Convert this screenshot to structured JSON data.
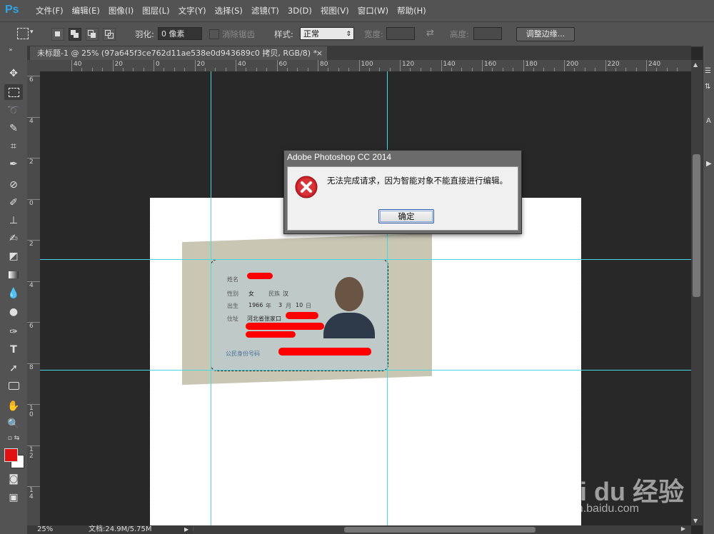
{
  "app": {
    "logo": "Ps"
  },
  "menu": [
    "文件(F)",
    "编辑(E)",
    "图像(I)",
    "图层(L)",
    "文字(Y)",
    "选择(S)",
    "滤镜(T)",
    "3D(D)",
    "视图(V)",
    "窗口(W)",
    "帮助(H)"
  ],
  "options": {
    "feather_label": "羽化:",
    "feather_value": "0 像素",
    "antialias_label": "消除锯齿",
    "style_label": "样式:",
    "style_value": "正常",
    "width_label": "宽度:",
    "height_label": "高度:",
    "refine_edge_button": "调整边缘..."
  },
  "document": {
    "tab_title": "未标题-1 @ 25% (97a645f3ce762d11ae538e0d943689c0 拷贝, RGB/8) *",
    "close_glyph": "×"
  },
  "ruler": {
    "top_labels": [
      "40",
      "20",
      "0",
      "20",
      "40",
      "60",
      "80",
      "100",
      "120",
      "140",
      "160",
      "180",
      "200",
      "220",
      "240"
    ],
    "left_labels": [
      "6",
      "4",
      "2",
      "0",
      "2",
      "4",
      "6",
      "8",
      "10",
      "12",
      "14"
    ]
  },
  "id_card": {
    "name_label": "姓名",
    "gender_label": "性别",
    "gender_value": "女",
    "ethnicity_label": "民族",
    "ethnicity_value": "汉",
    "birth_label": "出生",
    "birth_year": "1966",
    "year_unit": "年",
    "birth_month": "3",
    "month_unit": "月",
    "birth_day": "10",
    "day_unit": "日",
    "address_label": "住址",
    "address_value": "河北省张家口",
    "id_number_label": "公民身份号码"
  },
  "dialog": {
    "title": "Adobe Photoshop CC 2014",
    "message": "无法完成请求，因为智能对象不能直接进行编辑。",
    "ok_button": "确定"
  },
  "status": {
    "zoom": "25%",
    "doc_size": "文档:24.9M/5.75M"
  },
  "watermark": {
    "brand": "Bai du 经验",
    "url": "jingyan.baidu.com"
  },
  "colors": {
    "foreground": "#e01010",
    "background": "#ffffff",
    "guide": "#4ad8e0"
  }
}
